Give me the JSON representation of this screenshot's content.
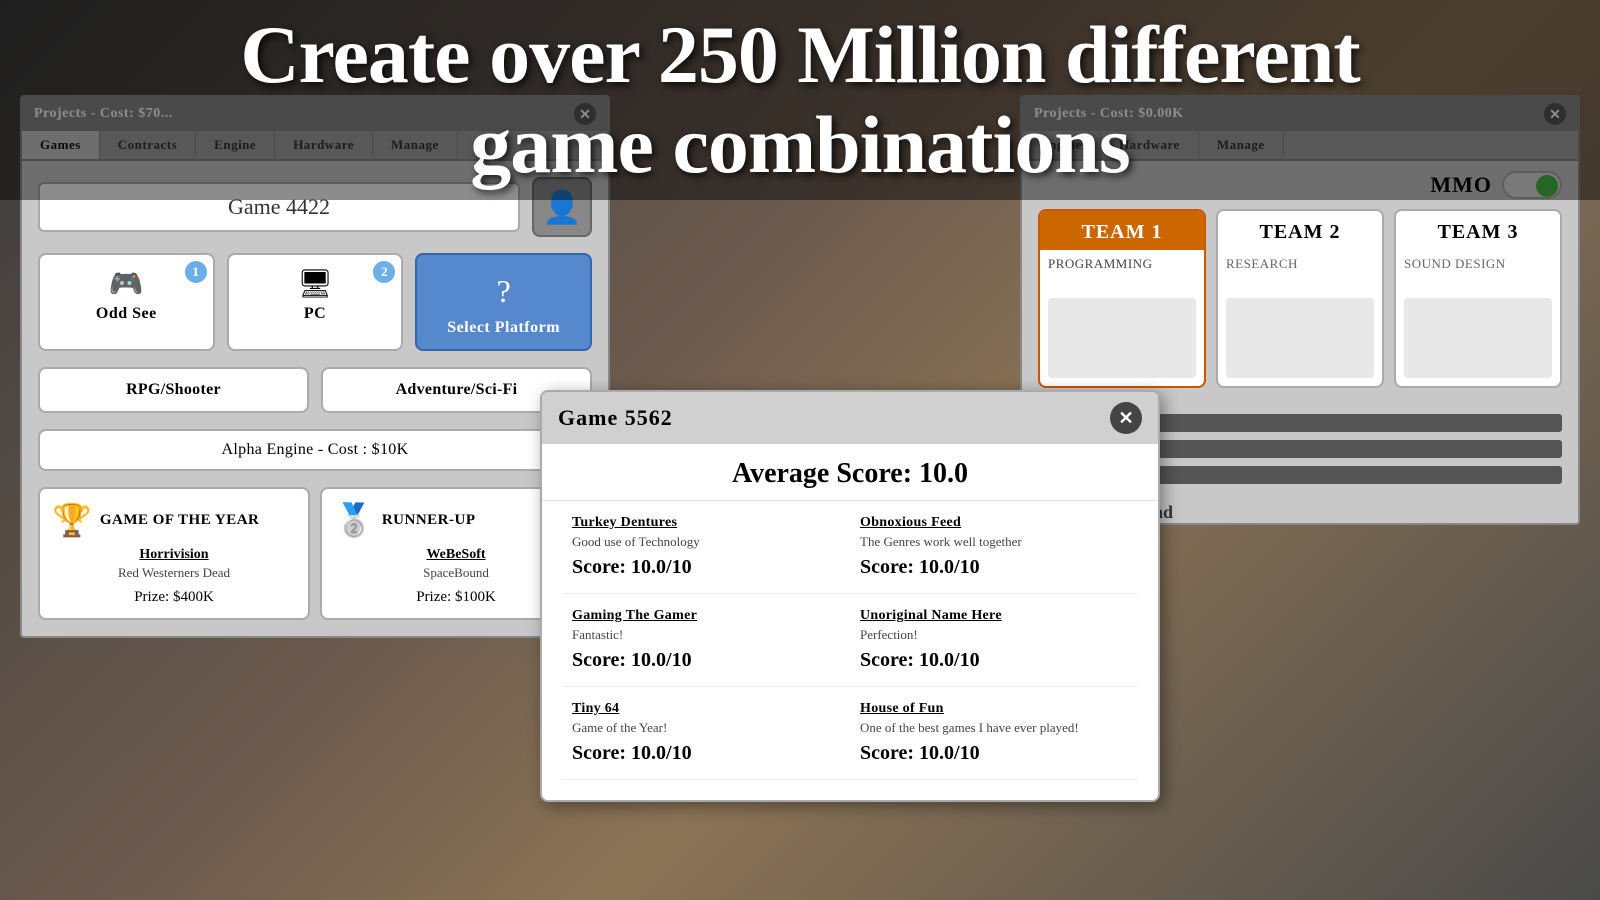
{
  "headline": {
    "line1": "Create over 250 Million different",
    "line2": "game combinations"
  },
  "panel_left": {
    "title_bar": "Projects - Cost: $70...",
    "tabs": [
      {
        "label": "Games",
        "active": false
      },
      {
        "label": "Contracts",
        "active": true
      },
      {
        "label": "Engine",
        "active": false
      },
      {
        "label": "Hardware",
        "active": false
      },
      {
        "label": "Manage",
        "active": false
      }
    ],
    "game_name": "Game 4422",
    "platforms": [
      {
        "name": "Odd See",
        "badge": "1",
        "icon": "🎮"
      },
      {
        "name": "PC",
        "badge": "2",
        "icon": "🖥"
      },
      {
        "name": "Select Platform",
        "icon": "?",
        "is_select": true
      }
    ],
    "genres": [
      {
        "label": "RPG/Shooter"
      },
      {
        "label": "Adventure/Sci-Fi"
      }
    ],
    "engine": "Alpha Engine - Cost : $10K",
    "awards": [
      {
        "type": "Game of the Year",
        "icon": "trophy",
        "company": "Horrivision",
        "game": "Red Westerners Dead",
        "prize": "Prize: $400K"
      },
      {
        "type": "Runner-up",
        "icon": "medal",
        "company": "WeBeSoft",
        "game": "SpaceBound",
        "prize": "Prize: $100K"
      }
    ]
  },
  "panel_right": {
    "title_bar": "Projects - Cost: $0.00K",
    "tabs": [
      {
        "label": "Engine",
        "active": false
      },
      {
        "label": "Hardware",
        "active": false
      },
      {
        "label": "Manage",
        "active": false
      }
    ],
    "mmo_label": "MMO",
    "teams": [
      {
        "name": "Team 1",
        "role": "Programming",
        "active": true
      },
      {
        "name": "Team 2",
        "role": "Research",
        "active": false
      },
      {
        "name": "Team 3",
        "role": "Sound Design",
        "active": false
      }
    ],
    "section_label": "Graphics, and Sound"
  },
  "score_panel": {
    "game_title": "Game 5562",
    "average_score_label": "Average Score: 10.0",
    "reviews": [
      {
        "source": "Turkey Dentures",
        "comment": "Good use of Technology",
        "score": "Score: 10.0/10"
      },
      {
        "source": "Obnoxious Feed",
        "comment": "The Genres work well together",
        "score": "Score: 10.0/10"
      },
      {
        "source": "Gaming The Gamer",
        "comment": "Fantastic!",
        "score": "Score: 10.0/10"
      },
      {
        "source": "Unoriginal Name Here",
        "comment": "Perfection!",
        "score": "Score: 10.0/10"
      },
      {
        "source": "Tiny 64",
        "comment": "Game of the Year!",
        "score": "Score: 10.0/10"
      },
      {
        "source": "House of Fun",
        "comment": "One of the best games I have ever played!",
        "score": "Score: 10.0/10"
      }
    ]
  },
  "team2_overlay": {
    "line1": "TEAM 2",
    "line2": "RESEARCH"
  },
  "icons": {
    "trophy": "🏆",
    "medal": "🥈",
    "close": "✕",
    "question": "?",
    "avatar": "👤"
  }
}
